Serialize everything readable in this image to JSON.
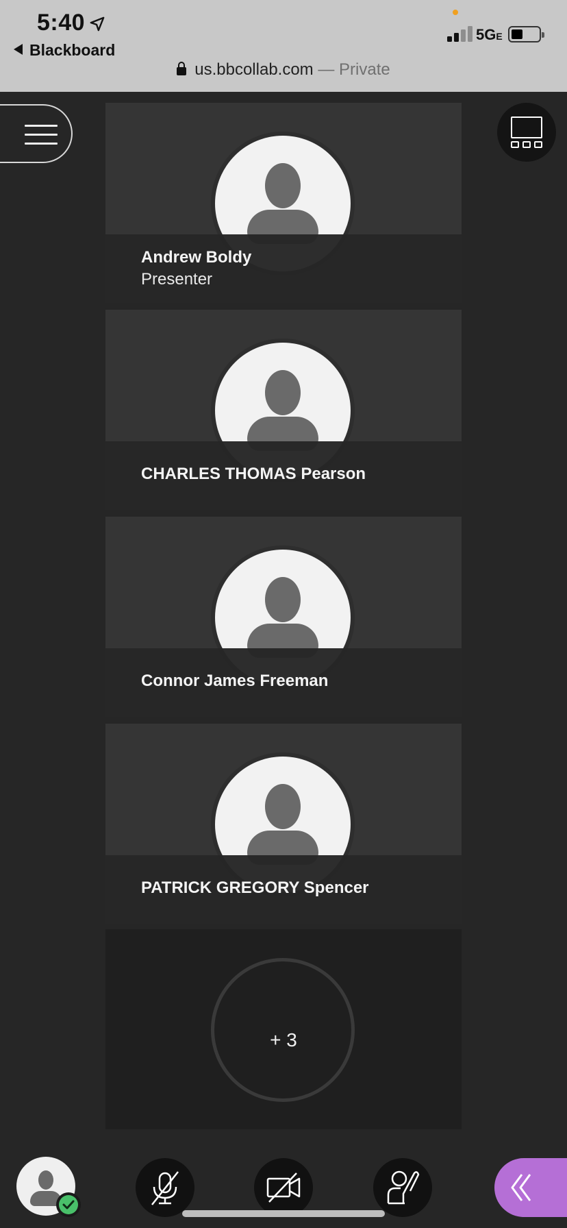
{
  "status_bar": {
    "time": "5:40",
    "back_app": "Blackboard",
    "network": "5G",
    "network_suffix": "E"
  },
  "browser": {
    "url": "us.bbcollab.com",
    "separator": " — ",
    "mode": "Private"
  },
  "participants": [
    {
      "name": "Andrew Boldy",
      "role": "Presenter"
    },
    {
      "name": "CHARLES THOMAS Pearson",
      "role": ""
    },
    {
      "name": "Connor James Freeman",
      "role": ""
    },
    {
      "name": "PATRICK GREGORY Spencer",
      "role": ""
    }
  ],
  "more_participants": "+ 3",
  "icons": {
    "menu": "hamburger-icon",
    "layout": "gallery-layout-icon",
    "mic": "microphone-muted-icon",
    "camera": "camera-off-icon",
    "hand": "raise-hand-icon",
    "collapse": "double-chevron-left-icon",
    "status": "checkmark-icon"
  },
  "colors": {
    "background": "#262626",
    "accent": "#b56fd6",
    "status_ok": "#49c06a"
  }
}
